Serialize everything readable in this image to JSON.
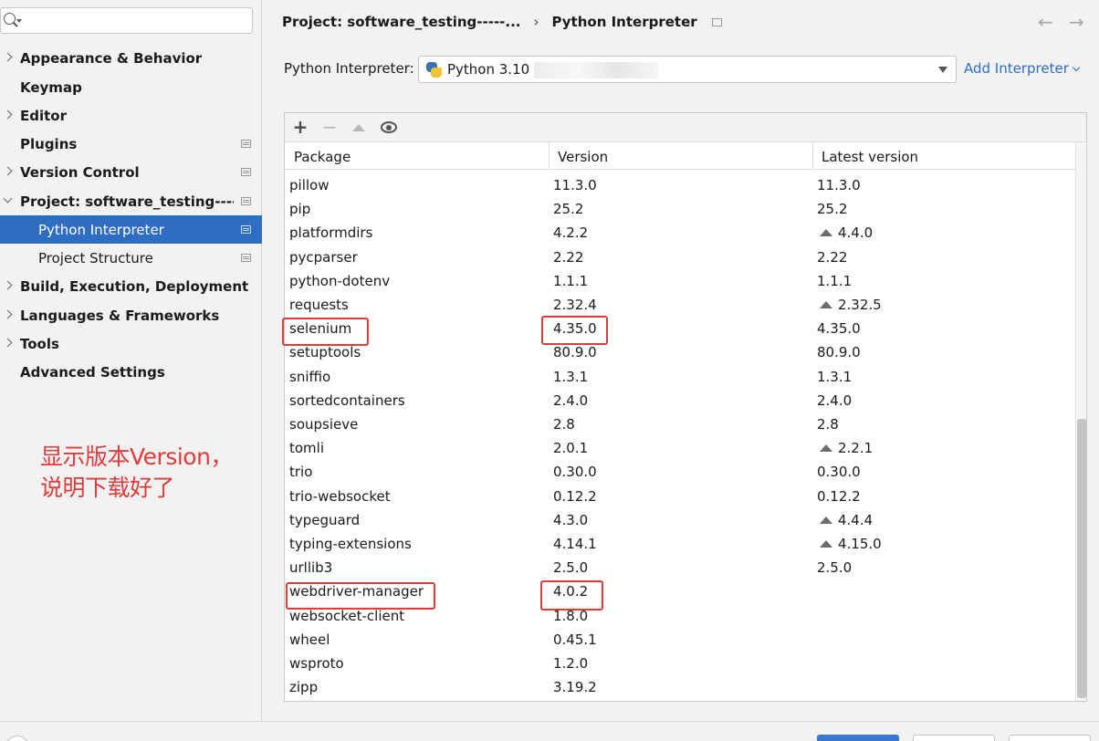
{
  "sidebar": {
    "search_value": "",
    "items": [
      {
        "label": "Appearance & Behavior",
        "expandable": true
      },
      {
        "label": "Keymap",
        "expandable": false
      },
      {
        "label": "Editor",
        "expandable": true
      },
      {
        "label": "Plugins",
        "expandable": false
      },
      {
        "label": "Version Control",
        "expandable": true
      },
      {
        "label": "Project: software_testing-----...",
        "expandable": true,
        "expanded": true
      },
      {
        "label": "Python Interpreter",
        "selected": true,
        "child": true
      },
      {
        "label": "Project Structure",
        "child": true
      },
      {
        "label": "Build, Execution, Deployment",
        "expandable": true
      },
      {
        "label": "Languages & Frameworks",
        "expandable": true
      },
      {
        "label": "Tools",
        "expandable": true
      },
      {
        "label": "Advanced Settings",
        "expandable": false
      }
    ]
  },
  "annotation": {
    "line1": "显示版本Version，",
    "line2": "说明下载好了"
  },
  "header": {
    "breadcrumb_project": "Project: software_testing-----...",
    "breadcrumb_sep": "›",
    "breadcrumb_page": "Python Interpreter",
    "back_arrow": "←",
    "forward_arrow": "→"
  },
  "interpreter": {
    "label": "Python Interpreter:",
    "value": "Python 3.10",
    "add_label": "Add Interpreter"
  },
  "toolbar": {
    "add": "+",
    "remove": "−"
  },
  "table": {
    "columns": [
      "Package",
      "Version",
      "Latest version"
    ],
    "partial_row": "",
    "rows": [
      {
        "package": "pillow",
        "version": "11.3.0",
        "latest": "11.3.0",
        "upgrade": false
      },
      {
        "package": "pip",
        "version": "25.2",
        "latest": "25.2",
        "upgrade": false
      },
      {
        "package": "platformdirs",
        "version": "4.2.2",
        "latest": "4.4.0",
        "upgrade": true
      },
      {
        "package": "pycparser",
        "version": "2.22",
        "latest": "2.22",
        "upgrade": false
      },
      {
        "package": "python-dotenv",
        "version": "1.1.1",
        "latest": "1.1.1",
        "upgrade": false
      },
      {
        "package": "requests",
        "version": "2.32.4",
        "latest": "2.32.5",
        "upgrade": true
      },
      {
        "package": "selenium",
        "version": "4.35.0",
        "latest": "4.35.0",
        "upgrade": false
      },
      {
        "package": "setuptools",
        "version": "80.9.0",
        "latest": "80.9.0",
        "upgrade": false
      },
      {
        "package": "sniffio",
        "version": "1.3.1",
        "latest": "1.3.1",
        "upgrade": false
      },
      {
        "package": "sortedcontainers",
        "version": "2.4.0",
        "latest": "2.4.0",
        "upgrade": false
      },
      {
        "package": "soupsieve",
        "version": "2.8",
        "latest": "2.8",
        "upgrade": false
      },
      {
        "package": "tomli",
        "version": "2.0.1",
        "latest": "2.2.1",
        "upgrade": true
      },
      {
        "package": "trio",
        "version": "0.30.0",
        "latest": "0.30.0",
        "upgrade": false
      },
      {
        "package": "trio-websocket",
        "version": "0.12.2",
        "latest": "0.12.2",
        "upgrade": false
      },
      {
        "package": "typeguard",
        "version": "4.3.0",
        "latest": "4.4.4",
        "upgrade": true
      },
      {
        "package": "typing-extensions",
        "version": "4.14.1",
        "latest": "4.15.0",
        "upgrade": true
      },
      {
        "package": "urllib3",
        "version": "2.5.0",
        "latest": "2.5.0",
        "upgrade": false
      },
      {
        "package": "webdriver-manager",
        "version": "4.0.2",
        "latest": "",
        "upgrade": false
      },
      {
        "package": "websocket-client",
        "version": "1.8.0",
        "latest": "",
        "upgrade": false
      },
      {
        "package": "wheel",
        "version": "0.45.1",
        "latest": "",
        "upgrade": false
      },
      {
        "package": "wsproto",
        "version": "1.2.0",
        "latest": "",
        "upgrade": false
      },
      {
        "package": "zipp",
        "version": "3.19.2",
        "latest": "",
        "upgrade": false
      }
    ]
  },
  "colors": {
    "accent": "#2f6dc3",
    "highlight": "#e13c3c"
  }
}
